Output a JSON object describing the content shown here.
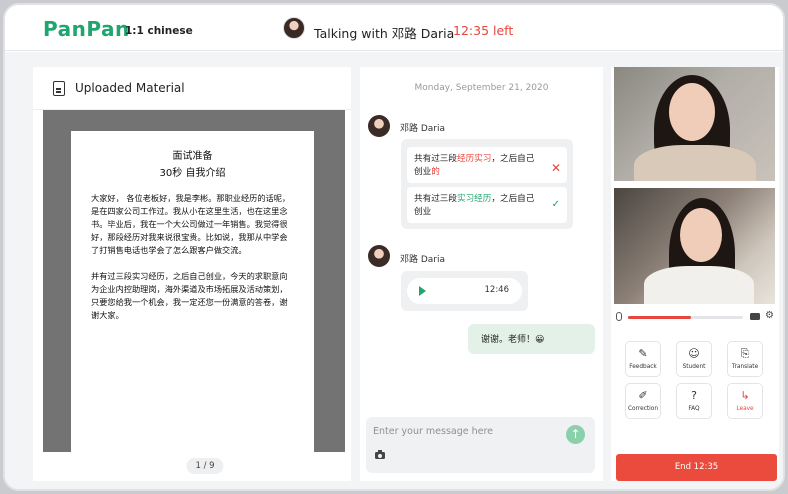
{
  "app": {
    "logo": "PanPan",
    "subtitle": "1:1 chinese"
  },
  "session": {
    "talking_with": "Talking with 邓路 Daria",
    "time_left": "12:35 left"
  },
  "material": {
    "title": "Uploaded Material",
    "doc_title": "面试准备",
    "doc_subtitle": "30秒 自我介绍",
    "paragraph1": "大家好， 各位老板好，我是李彬。那职业经历的话呢， 是在四家公司工作过。我从小在这里生活，也在这里念书。毕业后，我在一个大公司做过一年销售。我觉得很好，那段经历对我来说很宝贵。比如说，我那从中学会了打销售电话也学会了怎么跟客户做交流。",
    "paragraph2": "并有过三段实习经历，之后自己创业，今天的求职意向为企业内控助理岗，海外渠道及市场拓展及活动策划，只要您给我一个机会，我一定还您一份满意的答卷，谢谢大家。",
    "page_indicator": "1 / 9"
  },
  "chat": {
    "date": "Monday, September 21, 2020",
    "sender_name": "邓路 Daria",
    "correction": {
      "wrong_prefix": "共有过三段",
      "wrong_highlight": "经历实习",
      "wrong_mid": "，之后自己创业",
      "wrong_suffix": "的",
      "right_prefix": "共有过三段",
      "right_highlight": "实习经历",
      "right_suffix": "，之后自己创业"
    },
    "audio_duration": "12:46",
    "self_message": "谢谢。老师！😀",
    "input_placeholder": "Enter your message here"
  },
  "controls": {
    "volume_level": 0.55
  },
  "tools": [
    {
      "label": "Feedback",
      "icon": "feedback-icon"
    },
    {
      "label": "Student",
      "icon": "student-icon"
    },
    {
      "label": "Translate",
      "icon": "translate-icon"
    },
    {
      "label": "Correction",
      "icon": "correction-icon"
    },
    {
      "label": "FAQ",
      "icon": "faq-icon"
    },
    {
      "label": "Leave",
      "icon": "leave-icon"
    }
  ],
  "end_button": "End 12:35",
  "colors": {
    "brand": "#1fa56e",
    "alert": "#e8453c",
    "end_button": "#eb4b3c",
    "send_button": "#8ad1ab"
  }
}
